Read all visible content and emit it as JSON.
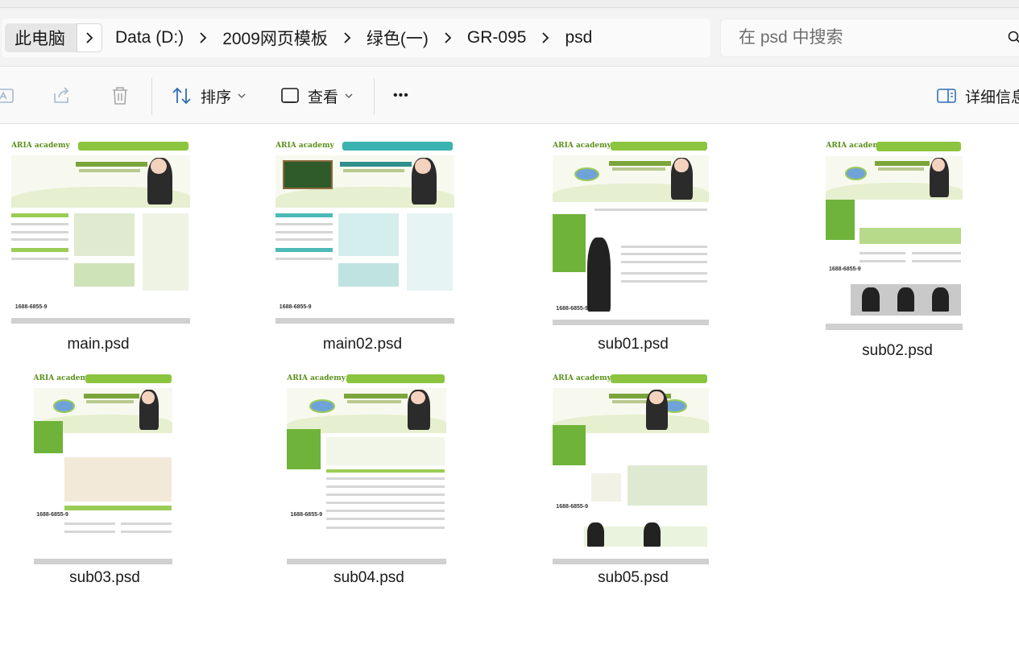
{
  "breadcrumb": {
    "items": [
      "此电脑",
      "Data (D:)",
      "2009网页模板",
      "绿色(一)",
      "GR-095",
      "psd"
    ]
  },
  "search": {
    "placeholder": "在 psd 中搜索"
  },
  "toolbar": {
    "sort_label": "排序",
    "view_label": "查看",
    "more_label": "•••",
    "details_label": "详细信息"
  },
  "files": [
    {
      "name": "main.psd",
      "theme": "green"
    },
    {
      "name": "main02.psd",
      "theme": "teal"
    },
    {
      "name": "sub01.psd",
      "theme": "green"
    },
    {
      "name": "sub02.psd",
      "theme": "green"
    },
    {
      "name": "sub03.psd",
      "theme": "green"
    },
    {
      "name": "sub04.psd",
      "theme": "green"
    },
    {
      "name": "sub05.psd",
      "theme": "green"
    }
  ],
  "thumbnail_text": {
    "logo": "ARIA academy",
    "phone": "1688-6855-9"
  },
  "colors": {
    "accent_green": "#8bc53f",
    "accent_teal": "#3bb3b0",
    "icon_blue": "#2f6fb5"
  }
}
